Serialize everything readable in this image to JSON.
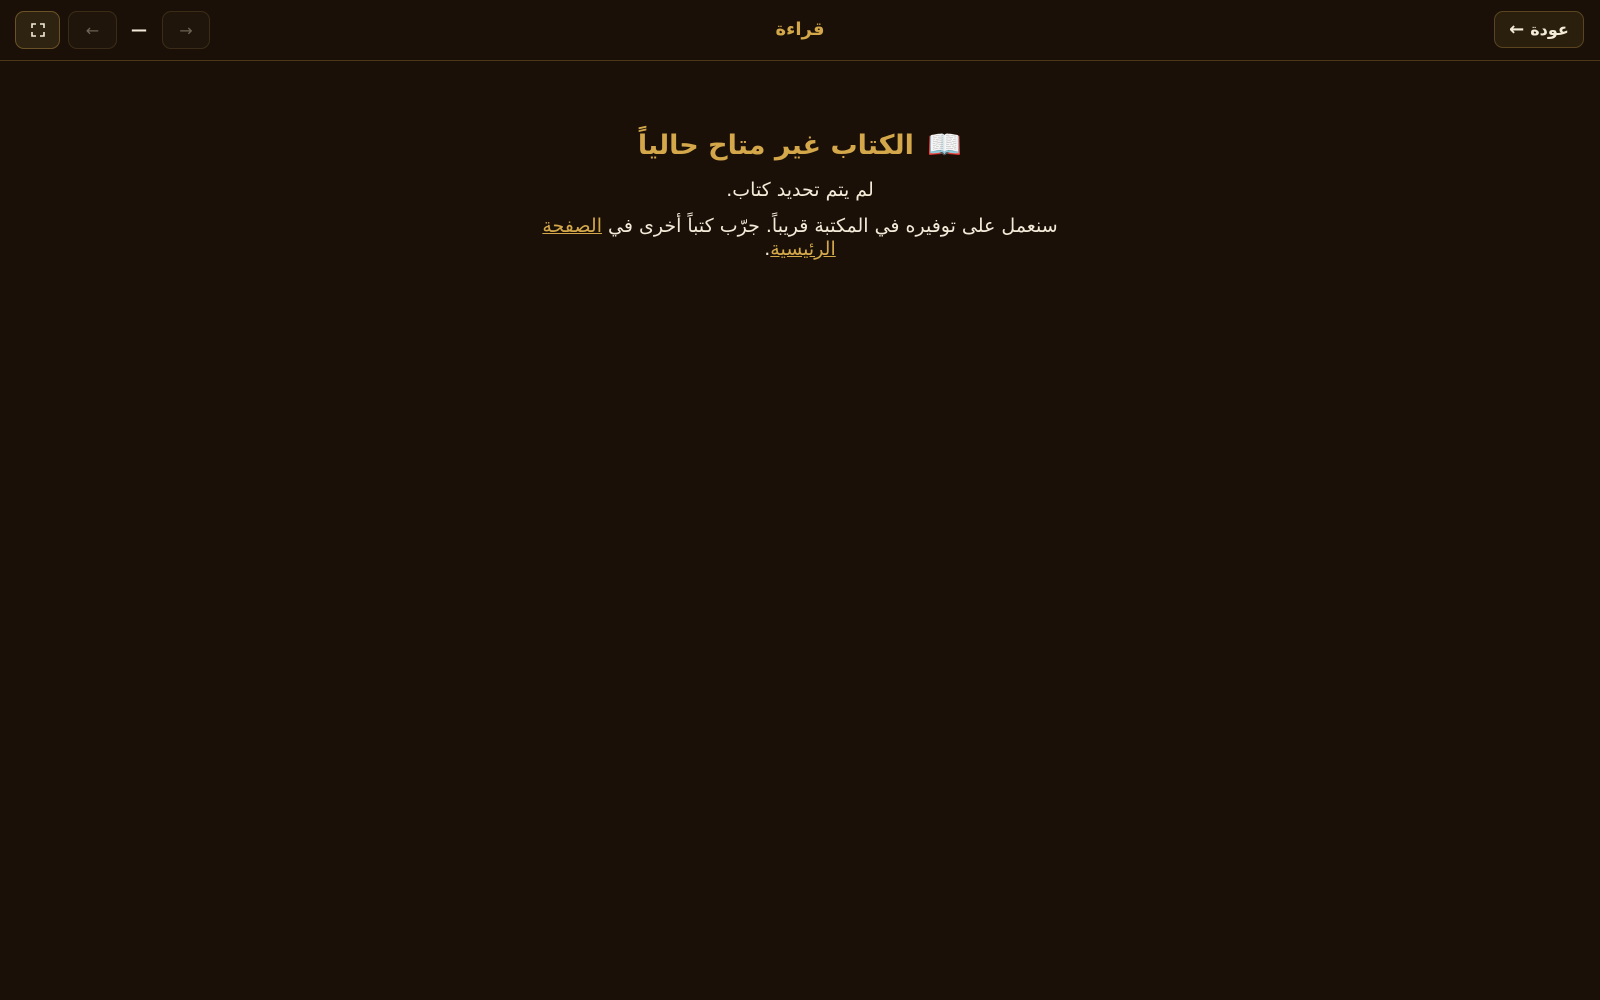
{
  "header": {
    "back_label": "عودة",
    "back_arrow": "←",
    "title": "قراءة",
    "page_indicator": "—",
    "prev_arrow": "←",
    "next_arrow": "→"
  },
  "icons": {
    "fullscreen": "fullscreen-icon",
    "book": "📖"
  },
  "main": {
    "headline": "الكتاب غير متاح حالياً",
    "subtitle": "لم يتم تحديد كتاب.",
    "notice_before": "سنعمل على توفيره في المكتبة قريباً. جرّب كتباً أخرى في ",
    "home_link": "الصفحة الرئيسية",
    "notice_after": "."
  },
  "colors": {
    "background": "#1a1008",
    "accent": "#d4a84a",
    "text": "#f3ead8"
  }
}
